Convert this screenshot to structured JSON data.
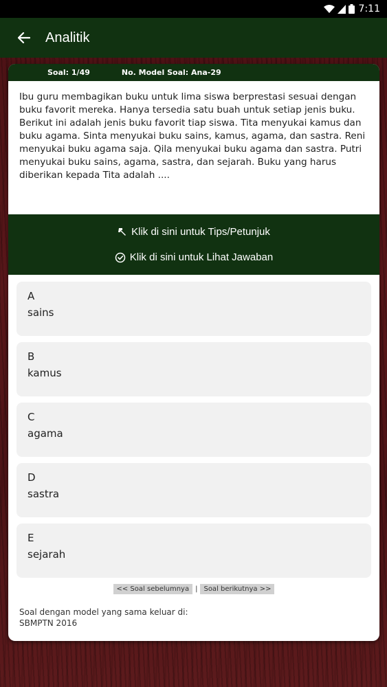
{
  "status_bar": {
    "time": "7:11"
  },
  "app_bar": {
    "title": "Analitik"
  },
  "card_header": {
    "soal": "Soal: 1/49",
    "model": "No. Model Soal: Ana-29"
  },
  "question": "Ibu guru membagikan buku untuk lima siswa berprestasi sesuai dengan buku favorit mereka. Hanya tersedia satu buah untuk setiap jenis buku. Berikut ini adalah jenis buku favorit tiap siswa. Tita menyukai kamus dan buku agama. Sinta menyukai buku sains, kamus, agama, dan sastra. Reni menyukai buku agama saja. Qila menyukai buku agama dan sastra. Putri menyukai buku sains, agama, sastra, dan sejarah. Buku yang harus diberikan kepada Tita adalah ....",
  "hints": {
    "tips": "Klik di sini untuk Tips/Petunjuk",
    "answer": "Klik di sini untuk Lihat Jawaban"
  },
  "options": [
    {
      "letter": "A",
      "text": "sains"
    },
    {
      "letter": "B",
      "text": "kamus"
    },
    {
      "letter": "C",
      "text": "agama"
    },
    {
      "letter": "D",
      "text": "sastra"
    },
    {
      "letter": "E",
      "text": "sejarah"
    }
  ],
  "nav": {
    "prev": "<< Soal sebelumnya",
    "sep": "|",
    "next": "Soal berikutnya >>"
  },
  "footer": {
    "line1": "Soal dengan model yang sama keluar di:",
    "line2": "SBMPTN 2016"
  }
}
